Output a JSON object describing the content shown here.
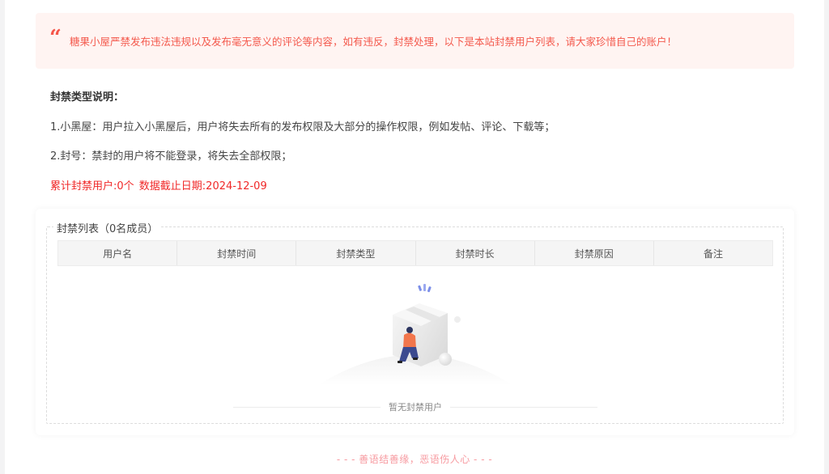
{
  "notice": {
    "quote_icon": "quote-icon",
    "text": "糖果小屋严禁发布违法违规以及发布毫无意义的评论等内容，如有违反，封禁处理，以下是本站封禁用户列表，请大家珍惜自己的账户！"
  },
  "ban_types": {
    "title": "封禁类型说明：",
    "rule1": "1.小黑屋：用户拉入小黑屋后，用户将失去所有的发布权限及大部分的操作权限，例如发帖、评论、下载等；",
    "rule2": "2.封号：禁封的用户将不能登录，将失去全部权限；"
  },
  "stats": {
    "total": "累计封禁用户:0个",
    "date": "数据截止日期:2024-12-09"
  },
  "ban_list": {
    "legend": "封禁列表（0名成员）",
    "columns": [
      "用户名",
      "封禁时间",
      "封禁类型",
      "封禁时长",
      "封禁原因",
      "备注"
    ],
    "empty_text": "暂无封禁用户"
  },
  "footer": {
    "text": "- - - 善语结善缘，恶语伤人心 - - -"
  },
  "colors": {
    "notice_bg": "#fff4f2",
    "notice_text": "#f45a4e",
    "stats_text": "#f02828",
    "footer_text": "#f79aa0"
  }
}
